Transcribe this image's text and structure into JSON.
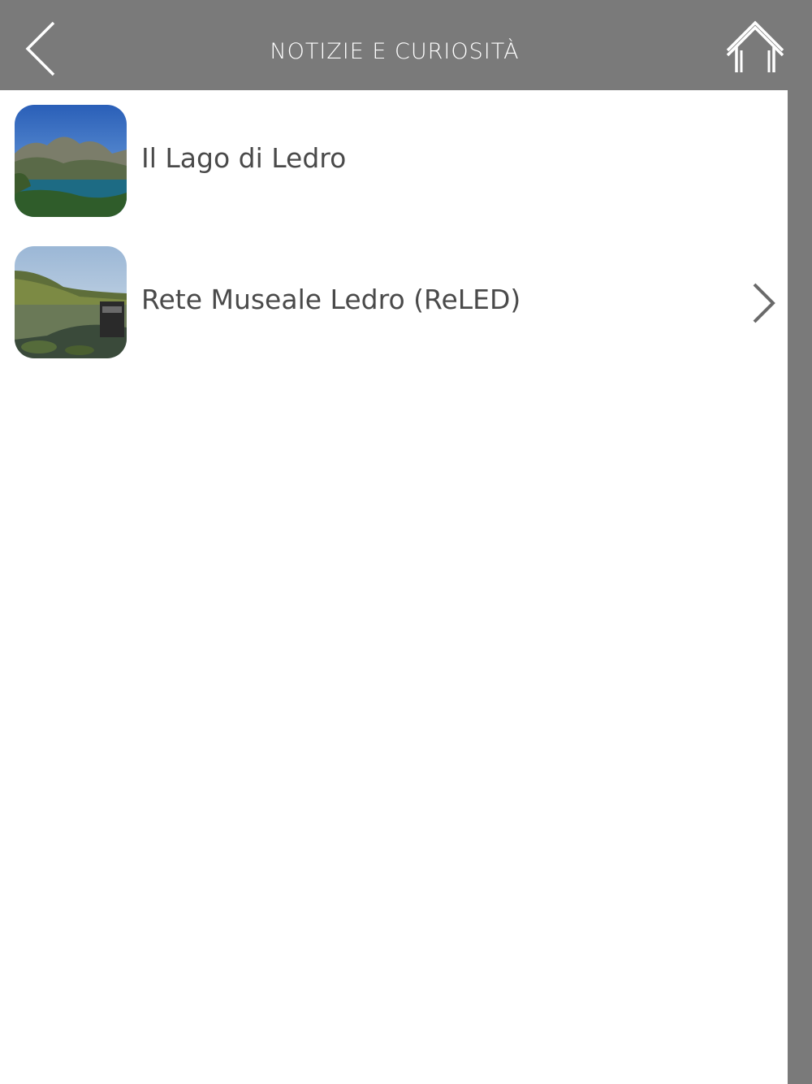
{
  "header": {
    "title": "NOTIZIE E CURIOSITÀ",
    "back_icon": "chevron-left-icon",
    "home_icon": "home-icon",
    "background": "#7a7a7a"
  },
  "list": {
    "items": [
      {
        "label": "Il Lago di Ledro",
        "thumbnail": "lake-landscape-image"
      },
      {
        "label": "Rete Museale Ledro (ReLED)",
        "thumbnail": "lake-reflection-image"
      }
    ],
    "disclosure_icon": "chevron-right-icon"
  }
}
